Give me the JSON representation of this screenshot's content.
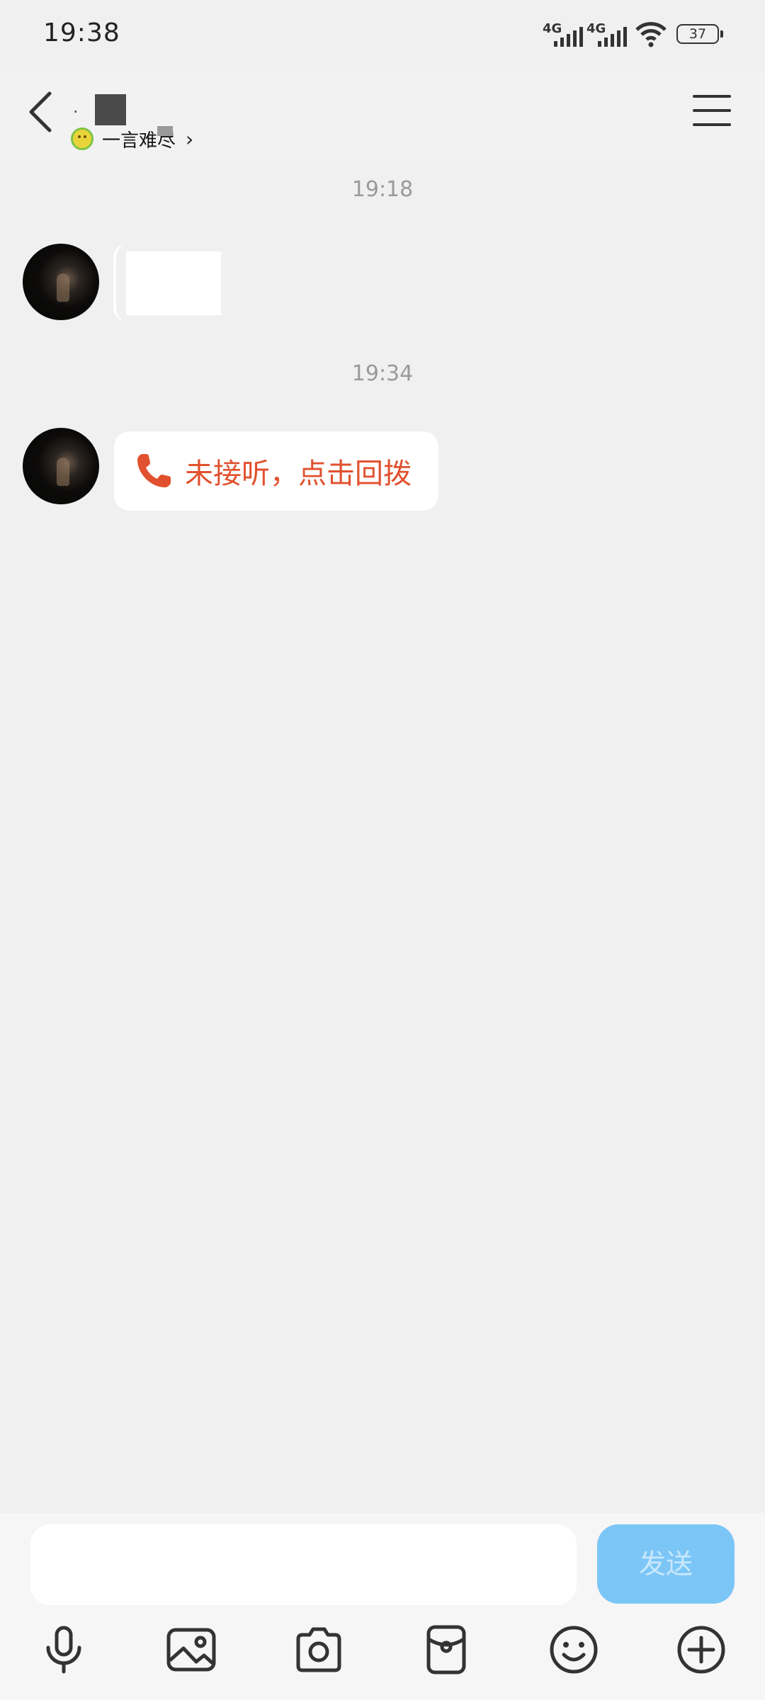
{
  "status_bar": {
    "time": "19:38",
    "signal1_label": "4G",
    "signal2_label": "4G",
    "battery": "37"
  },
  "header": {
    "name_prefix": "·",
    "subtitle": "一言难尽"
  },
  "chat": {
    "stamp1": "19:18",
    "stamp2": "19:34",
    "missed_call_text": "未接听，点击回拨"
  },
  "input_bar": {
    "send_label": "发送",
    "input_value": ""
  },
  "colors": {
    "accent_red": "#e1512f",
    "send_blue": "#7cc6f7"
  },
  "icons": [
    "back-arrow",
    "menu",
    "phone",
    "microphone",
    "image",
    "camera",
    "red-packet",
    "emoji",
    "plus"
  ]
}
